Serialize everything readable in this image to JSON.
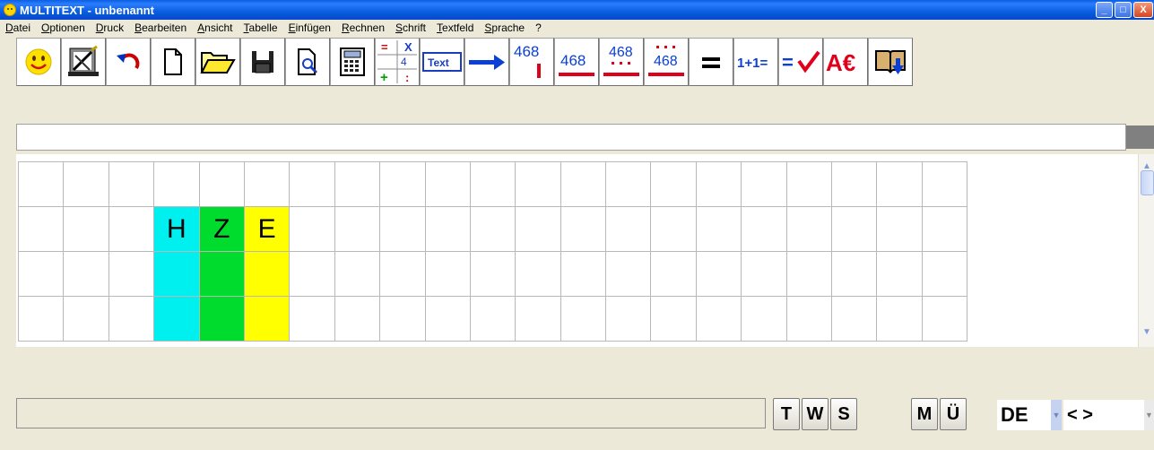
{
  "window": {
    "title": "MULTITEXT  -  unbenannt",
    "minimize_label": "_",
    "maximize_label": "□",
    "close_label": "X"
  },
  "menu": {
    "items": [
      "Datei",
      "Optionen",
      "Druck",
      "Bearbeiten",
      "Ansicht",
      "Tabelle",
      "Einfügen",
      "Rechnen",
      "Schrift",
      "Textfeld",
      "Sprache",
      "?"
    ]
  },
  "toolbar": {
    "buttons": [
      {
        "icon": "smiley-icon"
      },
      {
        "icon": "settings-tools-icon"
      },
      {
        "icon": "undo-arrow-icon"
      },
      {
        "icon": "new-document-icon"
      },
      {
        "icon": "open-folder-icon"
      },
      {
        "icon": "save-disk-icon"
      },
      {
        "icon": "print-preview-icon"
      },
      {
        "icon": "calculator-icon"
      },
      {
        "icon": "arithmetic-operators-icon",
        "labels": [
          "=",
          "X",
          "4",
          "+",
          ":"
        ]
      },
      {
        "icon": "text-box-icon",
        "label": "Text"
      },
      {
        "icon": "arrow-right-icon"
      },
      {
        "icon": "number-position-icon",
        "label": "468"
      },
      {
        "icon": "number-underline-icon",
        "label": "468"
      },
      {
        "icon": "number-dots-under-icon",
        "label": "468"
      },
      {
        "icon": "number-dots-over-icon",
        "label": "468"
      },
      {
        "icon": "equals-icon",
        "label": "="
      },
      {
        "icon": "addition-task-icon",
        "label": "1+1="
      },
      {
        "icon": "check-result-icon",
        "label": "="
      },
      {
        "icon": "currency-letters-icon",
        "label": "A€"
      },
      {
        "icon": "book-download-icon"
      }
    ],
    "colors": {
      "blue": "#0b3fd6",
      "red": "#e0001a"
    }
  },
  "input_line": {
    "value": ""
  },
  "grid": {
    "columns": 21,
    "rows": 4,
    "place_value_headers": [
      {
        "col": 3,
        "letter": "H",
        "color": "#00f0f0"
      },
      {
        "col": 4,
        "letter": "Z",
        "color": "#00dc2e"
      },
      {
        "col": 5,
        "letter": "E",
        "color": "#ffff00"
      }
    ]
  },
  "statusbar": {
    "text": "",
    "buttons": [
      "T",
      "W",
      "S",
      "M",
      "Ü"
    ],
    "language": "DE",
    "direction": "< >"
  }
}
